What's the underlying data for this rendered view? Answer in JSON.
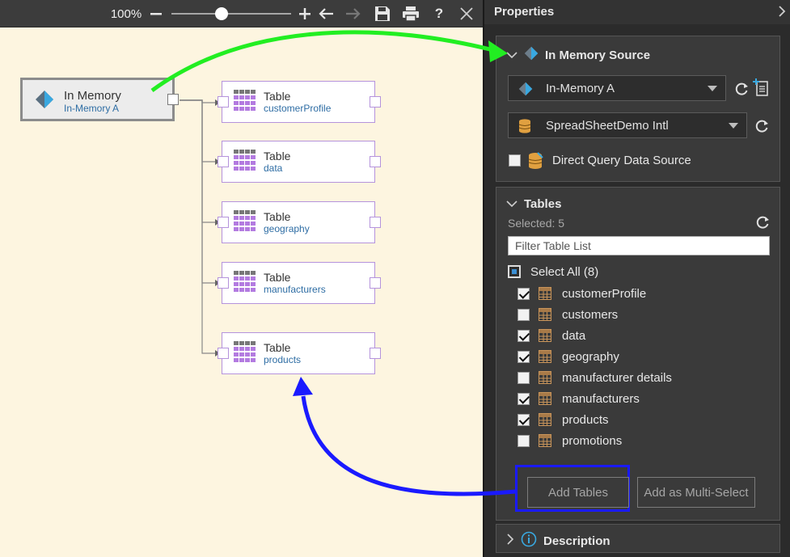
{
  "toolbar": {
    "zoom": "100%",
    "help": "?"
  },
  "source_node": {
    "title": "In Memory",
    "subtitle": "In-Memory A"
  },
  "table_nodes": [
    {
      "title": "Table",
      "name": "customerProfile"
    },
    {
      "title": "Table",
      "name": "data"
    },
    {
      "title": "Table",
      "name": "geography"
    },
    {
      "title": "Table",
      "name": "manufacturers"
    },
    {
      "title": "Table",
      "name": "products"
    }
  ],
  "properties": {
    "title": "Properties",
    "source_section": {
      "header": "In Memory Source",
      "source_value": "In-Memory A",
      "sheet_value": "SpreadSheetDemo Intl",
      "direct_query_label": "Direct Query Data Source"
    },
    "tables_section": {
      "header": "Tables",
      "selected": "Selected: 5",
      "filter_placeholder": "Filter Table List",
      "select_all": "Select All (8)",
      "items": [
        {
          "label": "customerProfile",
          "checked": true
        },
        {
          "label": "customers",
          "checked": false
        },
        {
          "label": "data",
          "checked": true
        },
        {
          "label": "geography",
          "checked": true
        },
        {
          "label": "manufacturer details",
          "checked": false
        },
        {
          "label": "manufacturers",
          "checked": true
        },
        {
          "label": "products",
          "checked": true
        },
        {
          "label": "promotions",
          "checked": false
        }
      ],
      "add_tables": "Add Tables",
      "add_multiselect": "Add as Multi-Select"
    },
    "description_section": {
      "header": "Description"
    }
  },
  "colors": {
    "canvas_bg": "#fdf5e0",
    "panel_bg": "#2b2b2b",
    "node_border": "#b593dc",
    "annotation_green": "#22ee22",
    "annotation_blue": "#1a1aff"
  }
}
